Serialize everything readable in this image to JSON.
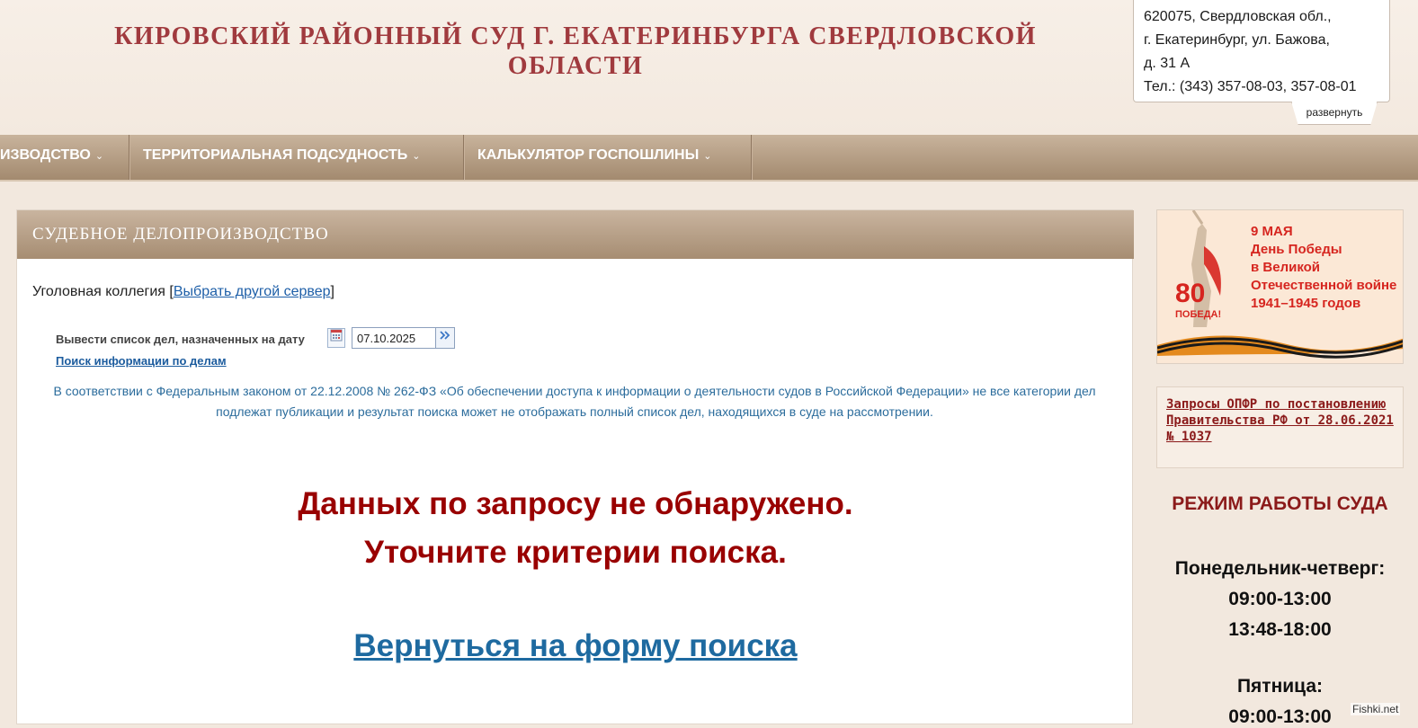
{
  "header": {
    "title": "КИРОВСКИЙ РАЙОННЫЙ СУД Г. ЕКАТЕРИНБУРГА СВЕРДЛОВСКОЙ ОБЛАСТИ",
    "address_lines": [
      "620075, Свердловская обл.,",
      "г. Екатеринбург, ул. Бажова,",
      "д. 31 А",
      "Тел.: (343) 357-08-03, 357-08-01"
    ],
    "expand_label": "развернуть"
  },
  "nav": {
    "items": [
      {
        "label": "ИЗВОДСТВО"
      },
      {
        "label": "ТЕРРИТОРИАЛЬНАЯ ПОДСУДНОСТЬ"
      },
      {
        "label": "КАЛЬКУЛЯТОР ГОСПОШЛИНЫ"
      }
    ],
    "chevron": "⌄"
  },
  "main": {
    "section_title": "СУДЕБНОЕ ДЕЛОПРОИЗВОДСТВО",
    "collegium_text": "Уголовная коллегия",
    "bracket_open": "[",
    "bracket_close": "]",
    "change_server_link": "Выбрать другой сервер",
    "date_label": "Вывести список дел, назначенных на дату",
    "date_value": "07.10.2025",
    "search_info_link": "Поиск информации по делам",
    "law_note": "В соответствии с Федеральным законом от 22.12.2008 № 262-ФЗ «Об обеспечении доступа к информации о деятельности судов в Российской Федерации» не все категории дел подлежат публикации и результат поиска может не отображать полный список дел, находящихся в суде на рассмотрении.",
    "no_data_line1": "Данных по запросу не обнаружено.",
    "no_data_line2": "Уточните критерии поиска.",
    "back_link": "Вернуться на форму поиска"
  },
  "sidebar": {
    "banner": {
      "line1": "9 МАЯ",
      "line2": "День Победы",
      "line3": "в Великой",
      "line4": "Отечественной войне",
      "line5": "1941–1945 годов",
      "number": "80",
      "pobeda": "ПОБЕДА!"
    },
    "opfr_link": "Запросы ОПФР по постановлению Правительства РФ от 28.06.2021 № 1037",
    "hours_title": "РЕЖИМ РАБОТЫ СУДА",
    "hours": [
      "Понедельник-четверг:",
      "09:00-13:00",
      "13:48-18:00",
      "Пятница:",
      "09:00-13:00"
    ]
  },
  "watermark": "Fishki.net",
  "colors": {
    "title_red": "#a03a3e",
    "nav_brown": "#a38a6f",
    "link_blue": "#1e5fa8",
    "error_red": "#990000"
  }
}
